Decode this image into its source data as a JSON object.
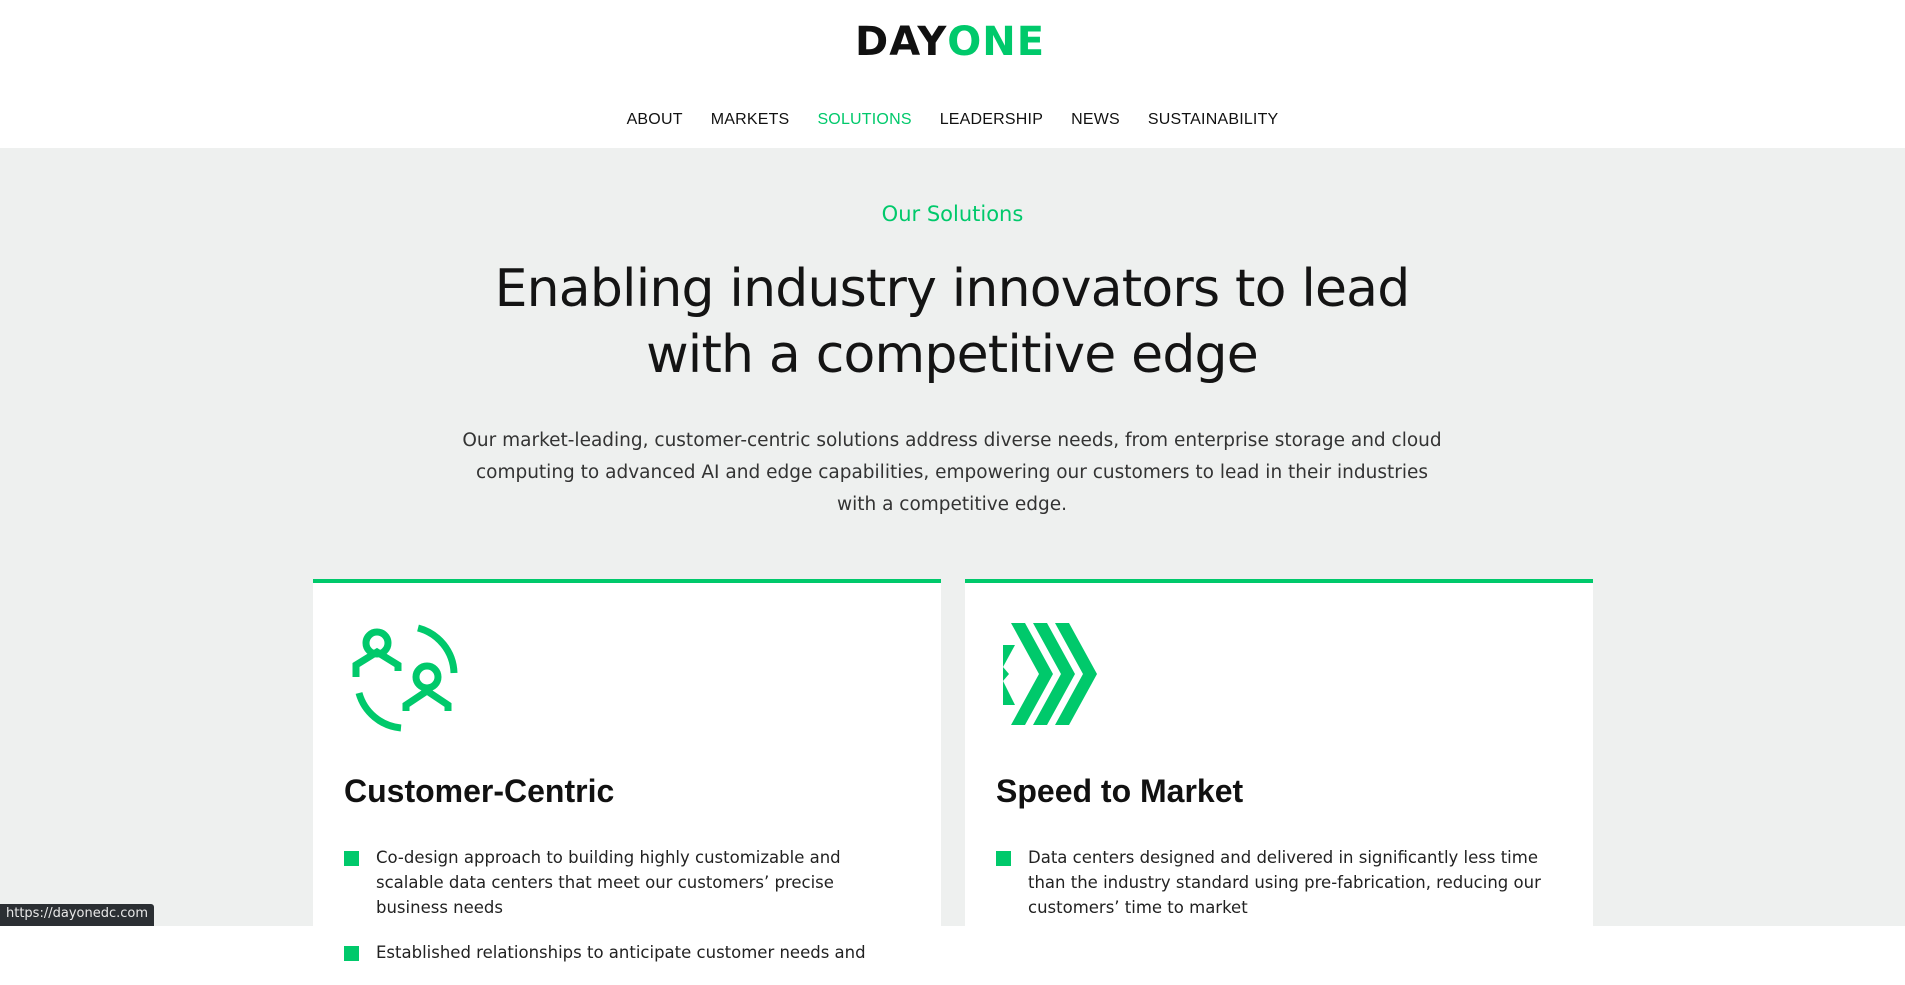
{
  "logo": {
    "part1": "DAY",
    "part2": "ONE"
  },
  "nav": {
    "items": [
      {
        "label": "ABOUT"
      },
      {
        "label": "MARKETS"
      },
      {
        "label": "SOLUTIONS",
        "active": true
      },
      {
        "label": "LEADERSHIP"
      },
      {
        "label": "NEWS"
      },
      {
        "label": "SUSTAINABILITY"
      }
    ]
  },
  "hero": {
    "eyebrow": "Our Solutions",
    "headline_line1": "Enabling industry innovators to lead",
    "headline_line2": "with a competitive edge",
    "lede": "Our market-leading, customer-centric solutions address diverse needs, from enterprise storage and cloud computing to advanced AI and edge capabilities, empowering our customers to lead in their industries with a competitive edge."
  },
  "cards": [
    {
      "icon": "people-exchange-icon",
      "title": "Customer-Centric",
      "bullets": [
        "Co-design approach to building highly customizable and scalable data centers that meet our customers’ precise business needs",
        "Established relationships to anticipate customer needs and"
      ]
    },
    {
      "icon": "chevrons-forward-icon",
      "title": "Speed to Market",
      "bullets": [
        "Data centers designed and delivered in significantly less time than the industry standard using pre-fabrication, reducing our customers’ time to market"
      ]
    }
  ],
  "status_bar": {
    "url": "https://dayonedc.com"
  },
  "colors": {
    "accent": "#00c96b",
    "section_bg": "#eef0ef",
    "text": "#111111"
  }
}
